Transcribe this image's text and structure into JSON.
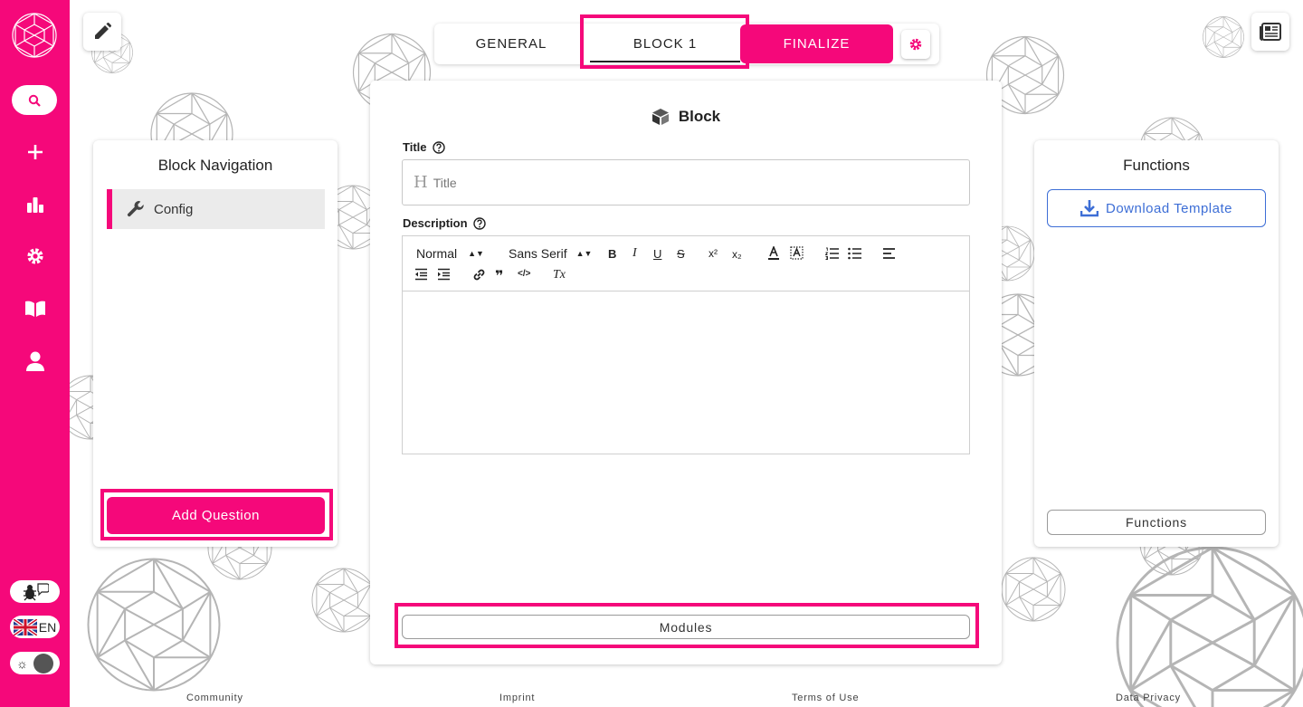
{
  "tabs": {
    "general": "GENERAL",
    "block": "BLOCK 1",
    "finalize": "FINALIZE"
  },
  "nav_panel": {
    "title": "Block Navigation",
    "item": "Config",
    "add_button": "Add Question"
  },
  "block": {
    "heading": "Block",
    "title_label": "Title",
    "title_placeholder": "Title",
    "description_label": "Description",
    "toolbar": {
      "format": "Normal",
      "font": "Sans Serif",
      "bold": "B",
      "italic": "I",
      "underline": "U",
      "strike": "S",
      "superscript": "x²",
      "subscript": "x₂",
      "quote": "❞",
      "code": "</>",
      "clear": "Tx"
    },
    "modules_button": "Modules"
  },
  "functions_panel": {
    "title": "Functions",
    "download": "Download Template",
    "functions_button": "Functions"
  },
  "sidebar": {
    "language": "EN"
  },
  "footer": {
    "community": "Community",
    "imprint": "Imprint",
    "terms": "Terms of Use",
    "privacy": "Data Privacy"
  },
  "colors": {
    "accent": "#f5087a",
    "link_blue": "#3d6ed6"
  }
}
